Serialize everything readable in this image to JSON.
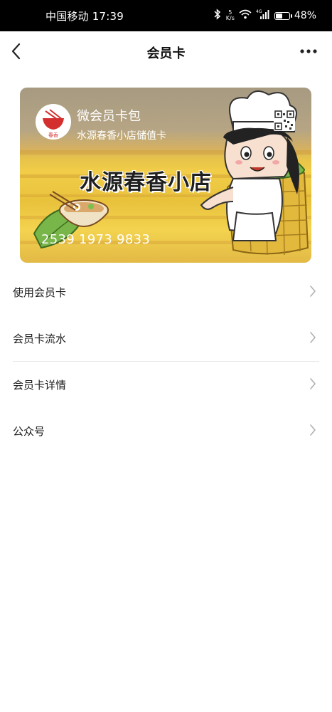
{
  "status_bar": {
    "carrier_time": "中国移动 17:39",
    "net_speed_value": "5",
    "net_speed_unit": "K/s",
    "network_type": "4G",
    "battery": "48%"
  },
  "nav": {
    "title": "会员卡",
    "back_icon": "chevron-left-icon",
    "more_icon": "more-horizontal-icon"
  },
  "card": {
    "brand": "微会员卡包",
    "subtitle": "水源春香小店储值卡",
    "shop_name": "水源春香小店",
    "card_number": "2539 1973 9833",
    "logo_text": "春香"
  },
  "menu": [
    {
      "label": "使用会员卡"
    },
    {
      "label": "会员卡流水"
    },
    {
      "label": "会员卡详情"
    },
    {
      "label": "公众号"
    }
  ],
  "colors": {
    "status_bar_bg": "#000000",
    "card_top": "#a69a81",
    "card_bottom": "#f1cd48",
    "divider": "#e6e6e6"
  }
}
